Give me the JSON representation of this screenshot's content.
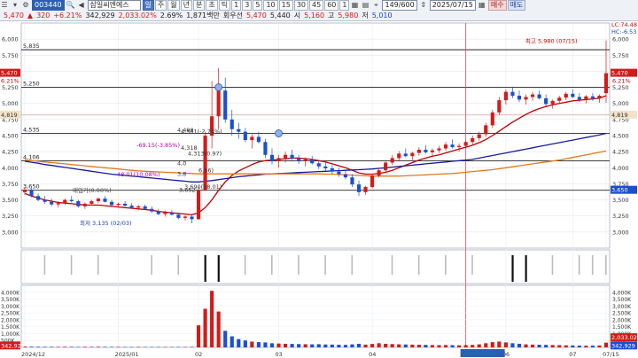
{
  "toolbar": {
    "row1": {
      "code": "003440",
      "name": "삼일씨엔에스",
      "mode_buttons": [
        "주",
        "월",
        "년",
        "분",
        "초",
        "틱"
      ],
      "periods": [
        "1",
        "3",
        "5",
        "10",
        "15",
        "30",
        "45",
        "60"
      ],
      "period_extra": "1",
      "count": "149/600",
      "date": "2025/07/15",
      "sell": "매수",
      "buy": "매도"
    },
    "row2": {
      "price": "5,470",
      "change": "320",
      "change_pct": "+6.21%",
      "volume": "342,929",
      "volume_pct": "2,033.02%",
      "turnover_pct": "2.69%",
      "amount": "1,871백만",
      "prev_label": "회우선",
      "prev_price": "5,470",
      "open": "5,440",
      "open_label": "시",
      "open_val": "5,160",
      "high_label": "고",
      "high_val": "5,980",
      "low_label": "저",
      "low_val": "5,010",
      "icon_name": "pin-icon"
    }
  },
  "chart_data": [
    {
      "type": "candlestick",
      "panel": "price",
      "x_start": "2024/12",
      "x_end": "2025/07/15",
      "ylim": [
        2750,
        6250
      ],
      "yticks": [
        "6,000",
        "5,750",
        "5,500",
        "5,250",
        "5,000",
        "4,750",
        "4,500",
        "4,250",
        "4,000",
        "3,750",
        "3,500",
        "3,250",
        "3,000"
      ],
      "right_axis_top": [
        "LC:74.48",
        "HC:-6.53"
      ],
      "right_labels": [
        "5,470",
        "6.21%",
        "4,819",
        "3,650"
      ],
      "left_labels": [
        "5,470",
        "6.21%",
        "4,819"
      ],
      "horizontal_lines": [
        {
          "value": 5835,
          "label": "5,835"
        },
        {
          "value": 5250,
          "label": "5,250"
        },
        {
          "value": 4535,
          "label": "4,535"
        },
        {
          "value": 4106,
          "label": "4,106"
        },
        {
          "value": 3650,
          "label": "3,650"
        }
      ],
      "annotations": [
        "최고 5,980 (07/15)",
        "최저 3,135 (02/03)",
        "4,561(-2.74%)",
        "4,498",
        "-69.15(-3.85%)",
        "4,318",
        "4,313(0.97)",
        "4,0",
        "3,8",
        "6.56)",
        "48.01(10.08%)",
        "3,690(58.01)",
        "3,652",
        "매입가(0.00%)",
        "3,650"
      ],
      "candles": [
        [
          3620,
          3700,
          3580,
          3660
        ],
        [
          3660,
          3680,
          3540,
          3560
        ],
        [
          3560,
          3600,
          3480,
          3500
        ],
        [
          3500,
          3560,
          3440,
          3470
        ],
        [
          3470,
          3520,
          3400,
          3430
        ],
        [
          3430,
          3480,
          3380,
          3450
        ],
        [
          3450,
          3520,
          3420,
          3500
        ],
        [
          3500,
          3560,
          3460,
          3480
        ],
        [
          3480,
          3500,
          3380,
          3400
        ],
        [
          3400,
          3460,
          3360,
          3440
        ],
        [
          3440,
          3500,
          3420,
          3480
        ],
        [
          3480,
          3540,
          3450,
          3520
        ],
        [
          3520,
          3560,
          3460,
          3470
        ],
        [
          3470,
          3500,
          3400,
          3420
        ],
        [
          3420,
          3460,
          3380,
          3440
        ],
        [
          3440,
          3480,
          3400,
          3410
        ],
        [
          3410,
          3450,
          3360,
          3380
        ],
        [
          3380,
          3420,
          3340,
          3400
        ],
        [
          3400,
          3430,
          3350,
          3360
        ],
        [
          3360,
          3400,
          3300,
          3320
        ],
        [
          3320,
          3360,
          3260,
          3280
        ],
        [
          3280,
          3330,
          3240,
          3300
        ],
        [
          3300,
          3340,
          3260,
          3270
        ],
        [
          3270,
          3300,
          3200,
          3220
        ],
        [
          3220,
          3260,
          3180,
          3240
        ],
        [
          3240,
          3280,
          3135,
          3200
        ],
        [
          3200,
          3700,
          3190,
          3650
        ],
        [
          3650,
          4560,
          3640,
          4498
        ],
        [
          4498,
          5350,
          4300,
          4800
        ],
        [
          4800,
          5550,
          4600,
          5200
        ],
        [
          5200,
          5400,
          4700,
          4750
        ],
        [
          4750,
          4900,
          4500,
          4600
        ],
        [
          4600,
          4700,
          4450,
          4560
        ],
        [
          4560,
          4620,
          4400,
          4430
        ],
        [
          4430,
          4520,
          4300,
          4480
        ],
        [
          4480,
          4560,
          4380,
          4400
        ],
        [
          4400,
          4450,
          4150,
          4200
        ],
        [
          4200,
          4300,
          4050,
          4100
        ],
        [
          4100,
          4200,
          4000,
          4150
        ],
        [
          4150,
          4250,
          4080,
          4200
        ],
        [
          4200,
          4280,
          4120,
          4140
        ],
        [
          4140,
          4200,
          4060,
          4100
        ],
        [
          4100,
          4160,
          4020,
          4130
        ],
        [
          4130,
          4180,
          4050,
          4070
        ],
        [
          4070,
          4120,
          3980,
          4020
        ],
        [
          4020,
          4080,
          3950,
          3990
        ],
        [
          3990,
          4040,
          3900,
          3940
        ],
        [
          3940,
          4000,
          3860,
          3900
        ],
        [
          3900,
          3960,
          3820,
          3850
        ],
        [
          3850,
          3900,
          3700,
          3740
        ],
        [
          3740,
          3800,
          3560,
          3620
        ],
        [
          3620,
          3720,
          3580,
          3700
        ],
        [
          3700,
          3900,
          3680,
          3880
        ],
        [
          3880,
          4000,
          3850,
          3960
        ],
        [
          3960,
          4100,
          3930,
          4080
        ],
        [
          4080,
          4200,
          4040,
          4150
        ],
        [
          4150,
          4260,
          4100,
          4220
        ],
        [
          4220,
          4300,
          4160,
          4180
        ],
        [
          4180,
          4250,
          4120,
          4230
        ],
        [
          4230,
          4320,
          4190,
          4280
        ],
        [
          4280,
          4350,
          4220,
          4240
        ],
        [
          4240,
          4300,
          4180,
          4270
        ],
        [
          4270,
          4340,
          4230,
          4300
        ],
        [
          4300,
          4400,
          4260,
          4360
        ],
        [
          4360,
          4440,
          4300,
          4320
        ],
        [
          4320,
          4380,
          4250,
          4340
        ],
        [
          4340,
          4420,
          4310,
          4400
        ],
        [
          4400,
          4500,
          4360,
          4460
        ],
        [
          4460,
          4560,
          4420,
          4520
        ],
        [
          4520,
          4700,
          4480,
          4660
        ],
        [
          4660,
          4900,
          4620,
          4860
        ],
        [
          4860,
          5100,
          4820,
          5050
        ],
        [
          5050,
          5220,
          4980,
          5180
        ],
        [
          5180,
          5260,
          5080,
          5120
        ],
        [
          5120,
          5200,
          5020,
          5060
        ],
        [
          5060,
          5140,
          4980,
          5100
        ],
        [
          5100,
          5180,
          5040,
          5140
        ],
        [
          5140,
          5200,
          5060,
          5080
        ],
        [
          5080,
          5140,
          4960,
          4990
        ],
        [
          4990,
          5060,
          4920,
          5040
        ],
        [
          5040,
          5120,
          5000,
          5090
        ],
        [
          5090,
          5180,
          5050,
          5150
        ],
        [
          5150,
          5220,
          5080,
          5100
        ],
        [
          5100,
          5160,
          5020,
          5060
        ],
        [
          5060,
          5130,
          5000,
          5110
        ],
        [
          5110,
          5160,
          5040,
          5080
        ],
        [
          5080,
          5140,
          5010,
          5120
        ],
        [
          5160,
          5980,
          5010,
          5470
        ]
      ],
      "ma_series": [
        {
          "color": "#c00000",
          "values": [
            3600,
            3560,
            3530,
            3500,
            3480,
            3460,
            3450,
            3440,
            3430,
            3420,
            3420,
            3420,
            3410,
            3400,
            3390,
            3380,
            3370,
            3360,
            3350,
            3340,
            3320,
            3310,
            3300,
            3290,
            3280,
            3270,
            3300,
            3380,
            3500,
            3650,
            3780,
            3880,
            3950,
            4000,
            4050,
            4090,
            4110,
            4120,
            4130,
            4140,
            4150,
            4150,
            4140,
            4130,
            4110,
            4090,
            4060,
            4030,
            4000,
            3960,
            3920,
            3900,
            3900,
            3910,
            3930,
            3960,
            4000,
            4040,
            4080,
            4120,
            4150,
            4180,
            4200,
            4230,
            4260,
            4290,
            4320,
            4350,
            4390,
            4440,
            4500,
            4570,
            4640,
            4710,
            4770,
            4830,
            4880,
            4920,
            4950,
            4980,
            5000,
            5020,
            5040,
            5050,
            5060,
            5070,
            5080,
            5120
          ]
        },
        {
          "color": "#1a1a9e",
          "values": [
            4100,
            4085,
            4070,
            4050,
            4035,
            4020,
            4005,
            3990,
            3975,
            3960,
            3945,
            3930,
            3915,
            3900,
            3890,
            3880,
            3870,
            3860,
            3850,
            3840,
            3830,
            3820,
            3810,
            3800,
            3790,
            3780,
            3780,
            3790,
            3800,
            3815,
            3830,
            3845,
            3860,
            3870,
            3880,
            3890,
            3900,
            3905,
            3910,
            3915,
            3920,
            3925,
            3930,
            3935,
            3940,
            3945,
            3950,
            3955,
            3960,
            3965,
            3970,
            3975,
            3980,
            3990,
            4000,
            4010,
            4020,
            4030,
            4040,
            4050,
            4060,
            4070,
            4080,
            4090,
            4100,
            4110,
            4120,
            4130,
            4150,
            4170,
            4190,
            4210,
            4230,
            4250,
            4270,
            4290,
            4310,
            4330,
            4350,
            4370,
            4390,
            4410,
            4430,
            4450,
            4470,
            4490,
            4510,
            4535
          ]
        },
        {
          "color": "#e07b1c",
          "values": [
            4120,
            4110,
            4100,
            4090,
            4080,
            4070,
            4060,
            4050,
            4040,
            4030,
            4020,
            4010,
            4000,
            3990,
            3980,
            3970,
            3960,
            3950,
            3945,
            3940,
            3935,
            3930,
            3925,
            3920,
            3915,
            3910,
            3905,
            3905,
            3905,
            3905,
            3905,
            3905,
            3905,
            3905,
            3905,
            3905,
            3905,
            3905,
            3905,
            3905,
            3905,
            3905,
            3905,
            3905,
            3905,
            3900,
            3900,
            3895,
            3890,
            3885,
            3880,
            3875,
            3870,
            3870,
            3870,
            3870,
            3870,
            3875,
            3880,
            3885,
            3890,
            3895,
            3900,
            3905,
            3910,
            3920,
            3930,
            3940,
            3950,
            3960,
            3970,
            3985,
            4000,
            4015,
            4030,
            4045,
            4060,
            4075,
            4090,
            4105,
            4120,
            4140,
            4160,
            4180,
            4200,
            4220,
            4240,
            4260
          ]
        }
      ],
      "x_labels": [
        "2024/12",
        "2025/01",
        "02",
        "03",
        "04",
        "2025/05/14(수)",
        "06",
        "07",
        "07/15"
      ]
    },
    {
      "type": "bar",
      "panel": "signal",
      "ylim": [
        0,
        1
      ]
    },
    {
      "type": "bar",
      "panel": "volume",
      "ylim": [
        0,
        4500000
      ],
      "yticks": [
        "4,000K",
        "3,500K",
        "3,000K",
        "2,500K",
        "2,000K",
        "1,500K",
        "1,000K",
        "500K"
      ],
      "right_labels": [
        "2,033.02%",
        "342,929"
      ],
      "values": [
        60000,
        50000,
        45000,
        40000,
        42000,
        38000,
        45000,
        40000,
        35000,
        42000,
        38000,
        45000,
        40000,
        36000,
        38000,
        34000,
        32000,
        36000,
        30000,
        32000,
        34000,
        30000,
        28000,
        32000,
        30000,
        35000,
        1600000,
        2800000,
        4100000,
        2600000,
        1200000,
        800000,
        600000,
        500000,
        420000,
        380000,
        360000,
        300000,
        280000,
        260000,
        250000,
        240000,
        230000,
        220000,
        230000,
        210000,
        200000,
        190000,
        180000,
        220000,
        260000,
        200000,
        250000,
        300000,
        260000,
        240000,
        220000,
        210000,
        200000,
        190000,
        180000,
        170000,
        160000,
        170000,
        160000,
        150000,
        160000,
        180000,
        220000,
        300000,
        380000,
        420000,
        360000,
        300000,
        260000,
        220000,
        200000,
        190000,
        180000,
        170000,
        160000,
        150000,
        140000,
        130000,
        120000,
        130000,
        140000,
        342929
      ]
    }
  ],
  "colors": {
    "up": "#d21b1b",
    "down": "#1b4fd2",
    "accent": "#2b5fb3"
  }
}
